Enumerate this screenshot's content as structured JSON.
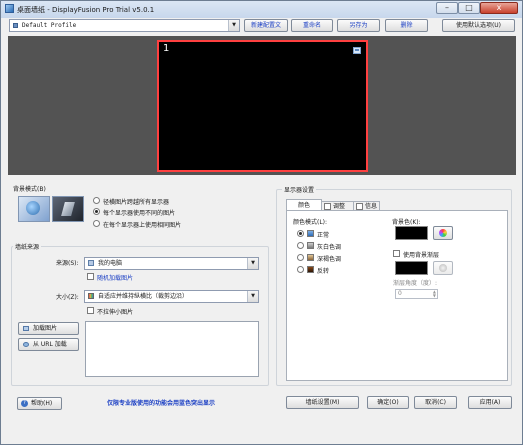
{
  "window": {
    "title": "桌面墙纸 - DisplayFusion Pro Trial v5.0.1",
    "icon": "monitor-icon",
    "caption_minimize": "–",
    "caption_maximize": "□",
    "caption_close": "x"
  },
  "toolbar": {
    "profile_value": "Default Profile",
    "new_profile": "新建配置文",
    "rename": "重命名",
    "save_as": "另存为",
    "delete": "删除",
    "use_defaults": "使用默认选项(U)"
  },
  "preview": {
    "monitor_number": "1",
    "monitor_badge_icon": "monitor-settings-icon",
    "background": "#535353",
    "monitor_border": "#ff4040"
  },
  "background_mode": {
    "title": "背景模式(B)",
    "options": [
      "径横图片跨越所有显示器",
      "每个显示器使用不同的图片",
      "在每个显示器上使用相同图片"
    ],
    "selected_index": 1
  },
  "source": {
    "title": "墙纸来源",
    "source_label": "来源(S):",
    "source_value": "我的电脑",
    "random_label": "随机加载图片",
    "size_label": "大小(Z):",
    "size_value": "自适应并维持纵横比（裁剪边沿）",
    "no_small_label": "不拉伸小图片",
    "load_image": "加载图片",
    "load_url": "从 URL 加载"
  },
  "monitor_settings": {
    "title": "显示器设置",
    "tabs": [
      "颜色",
      "调整",
      "信息"
    ],
    "active_tab": 0,
    "color_mode_label": "颜色模式(L):",
    "color_modes": [
      "正常",
      "灰白色调",
      "深褐色调",
      "反转"
    ],
    "selected_color_mode": 0,
    "bg_color_label": "背景色(K):",
    "bg_color": "#000000",
    "use_gradient_label": "使用背景渐层",
    "gradient_color": "#000000",
    "gradient_angle_label": "渐层角度（度）:",
    "gradient_angle_value": "0"
  },
  "footer": {
    "help": "帮助(H)",
    "pro_note": "仅限专业版使用的功能会用蓝色突出显示",
    "wallpaper_settings": "墙纸设置(M)",
    "ok": "确定(O)",
    "cancel": "取消(C)",
    "apply": "应用(A)"
  }
}
